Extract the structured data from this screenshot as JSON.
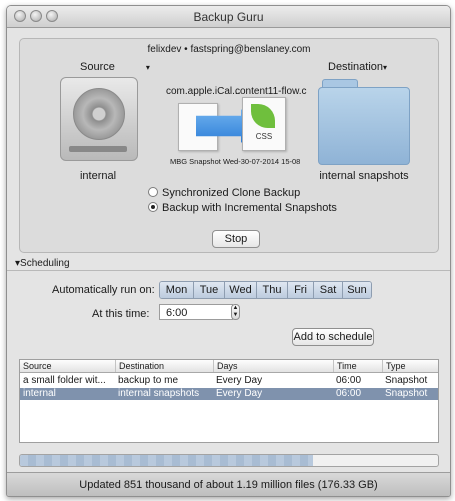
{
  "window": {
    "title": "Backup Guru"
  },
  "account": "felixdev • fastspring@benslaney.com",
  "source": {
    "label": "Source",
    "caret": "▾",
    "name": "internal",
    "icon": "hard-disk-icon"
  },
  "destination": {
    "label": "Destination",
    "caret": "▾",
    "name": "internal snapshots",
    "icon": "folder-icon"
  },
  "transfer": {
    "from_file": "com.apple.iCal...",
    "to_file": "content11-flow.c",
    "file_type": "CSS",
    "snapshot_label": "MBG Snapshot Wed-30-07-2014 15-08"
  },
  "modes": [
    {
      "label": "Synchronized Clone Backup",
      "selected": false
    },
    {
      "label": "Backup with Incremental Snapshots",
      "selected": true
    }
  ],
  "stop_label": "Stop",
  "scheduling": {
    "header": "Scheduling",
    "auto_label": "Automatically run on:",
    "days": [
      "Mon",
      "Tue",
      "Wed",
      "Thu",
      "Fri",
      "Sat",
      "Sun"
    ],
    "time_label": "At this time:",
    "time_value": "6:00",
    "add_label": "Add to schedule"
  },
  "schedule_table": {
    "headers": [
      "Source",
      "Destination",
      "Days",
      "Time",
      "Type"
    ],
    "rows": [
      [
        "a small folder wit...",
        "backup to me",
        "Every Day",
        "06:00",
        "Snapshot"
      ],
      [
        "internal",
        "internal snapshots",
        "Every Day",
        "06:00",
        "Snapshot"
      ]
    ],
    "selected_row": 1
  },
  "progress": {
    "fraction": 0.7
  },
  "status": "Updated 851 thousand of about 1.19 million files (176.33 GB)"
}
